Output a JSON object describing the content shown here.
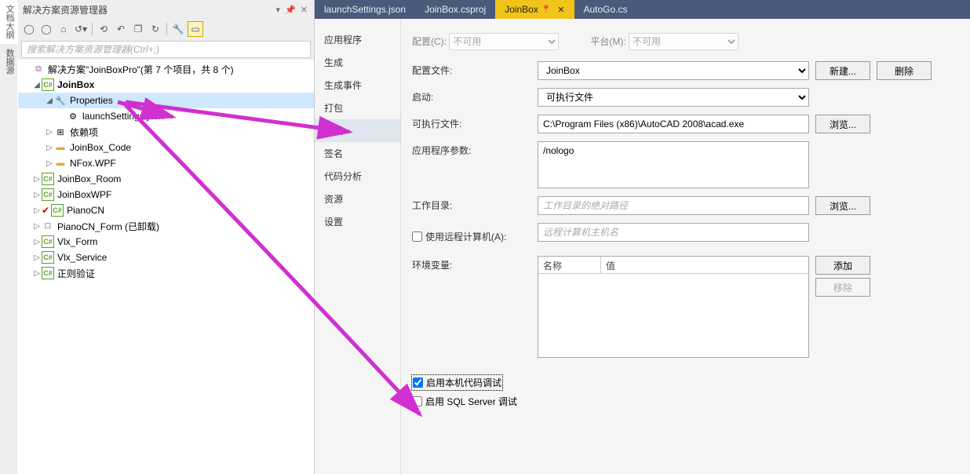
{
  "explorer": {
    "title": "解决方案资源管理器",
    "search_ph": "搜索解决方案资源管理器(Ctrl+;)",
    "solution": "解决方案\"JoinBoxPro\"(第 7 个项目，共 8 个)",
    "tree": {
      "p0": "JoinBox",
      "p0_prop": "Properties",
      "p0_launch": "launchSettings.json",
      "p0_dep": "依赖项",
      "p0_code": "JoinBox_Code",
      "p0_nfox": "NFox.WPF",
      "p1": "JoinBox_Room",
      "p2": "JoinBoxWPF",
      "p3": "PianoCN",
      "p4": "PianoCN_Form (已卸载)",
      "p5": "Vlx_Form",
      "p6": "Vlx_Service",
      "p7": "正则验证"
    }
  },
  "left_tabs": {
    "t1": "文档大纲",
    "t2": "数据源"
  },
  "doctabs": {
    "t1": "launchSettings.json",
    "t2": "JoinBox.csproj",
    "t3": "JoinBox",
    "t4": "AutoGo.cs"
  },
  "sidebar": {
    "i0": "应用程序",
    "i1": "生成",
    "i2": "生成事件",
    "i3": "打包",
    "i4": "调试",
    "i5": "签名",
    "i6": "代码分析",
    "i7": "资源",
    "i8": "设置"
  },
  "props": {
    "config_l": "配置(C):",
    "config_v": "不可用",
    "platform_l": "平台(M):",
    "platform_v": "不可用",
    "profile_l": "配置文件:",
    "profile_v": "JoinBox",
    "new_btn": "新建...",
    "del_btn": "删除",
    "launch_l": "启动:",
    "launch_v": "可执行文件",
    "exe_l": "可执行文件:",
    "exe_v": "C:\\Program Files (x86)\\AutoCAD 2008\\acad.exe",
    "browse": "浏览...",
    "args_l": "应用程序参数:",
    "args_v": "/nologo",
    "workdir_l": "工作目录:",
    "workdir_ph": "工作目录的绝对路径",
    "remote_l": "使用远程计算机(A):",
    "remote_ph": "远程计算机主机名",
    "env_l": "环境变量:",
    "env_c1": "名称",
    "env_c2": "值",
    "add_btn": "添加",
    "rm_btn": "移除",
    "chk_native": "启用本机代码调试",
    "chk_sql": "启用 SQL Server 调试"
  }
}
